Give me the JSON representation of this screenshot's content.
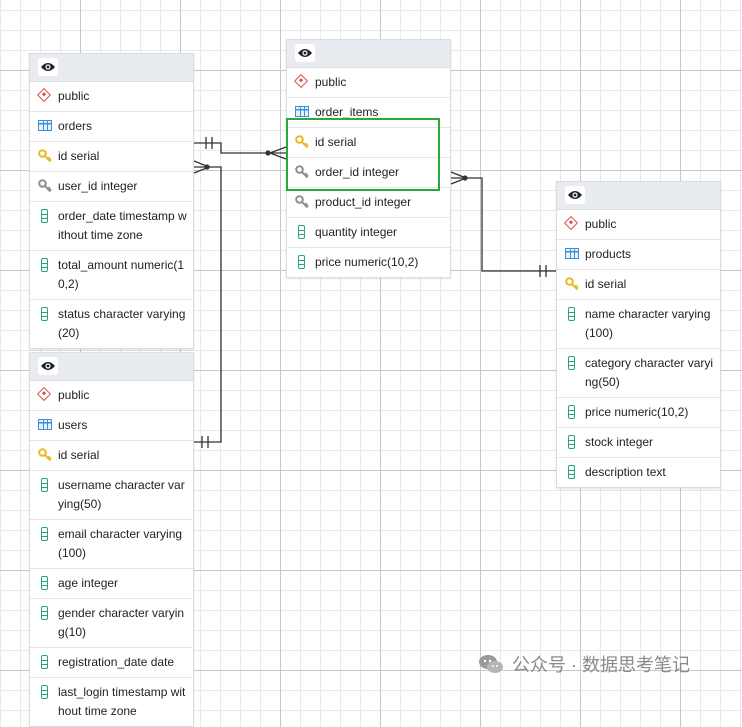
{
  "tables": [
    {
      "id": "orders",
      "schema": "public",
      "name": "orders",
      "columns": [
        {
          "text": "id serial",
          "kind": "pk"
        },
        {
          "text": "user_id integer",
          "kind": "fk"
        },
        {
          "text": "order_date timestamp without time zone",
          "kind": "col"
        },
        {
          "text": "total_amount numeric(10,2)",
          "kind": "col"
        },
        {
          "text": "status character varying(20)",
          "kind": "col"
        }
      ]
    },
    {
      "id": "order_items",
      "schema": "public",
      "name": "order_items",
      "columns": [
        {
          "text": "id serial",
          "kind": "pk"
        },
        {
          "text": "order_id integer",
          "kind": "fk"
        },
        {
          "text": "product_id integer",
          "kind": "fk"
        },
        {
          "text": "quantity integer",
          "kind": "col"
        },
        {
          "text": "price numeric(10,2)",
          "kind": "col"
        }
      ]
    },
    {
      "id": "products",
      "schema": "public",
      "name": "products",
      "columns": [
        {
          "text": "id serial",
          "kind": "pk"
        },
        {
          "text": "name character varying(100)",
          "kind": "col"
        },
        {
          "text": "category character varying(50)",
          "kind": "col"
        },
        {
          "text": "price numeric(10,2)",
          "kind": "col"
        },
        {
          "text": "stock integer",
          "kind": "col"
        },
        {
          "text": "description text",
          "kind": "col"
        }
      ]
    },
    {
      "id": "users",
      "schema": "public",
      "name": "users",
      "columns": [
        {
          "text": "id serial",
          "kind": "pk"
        },
        {
          "text": "username character varying(50)",
          "kind": "col"
        },
        {
          "text": "email character varying(100)",
          "kind": "col"
        },
        {
          "text": "age integer",
          "kind": "col"
        },
        {
          "text": "gender character varying(10)",
          "kind": "col"
        },
        {
          "text": "registration_date date",
          "kind": "col"
        },
        {
          "text": "last_login timestamp without time zone",
          "kind": "col"
        }
      ]
    }
  ],
  "relationships": [
    {
      "from": "order_items.order_id",
      "to": "orders.id",
      "cardinality": "many-to-one"
    },
    {
      "from": "order_items.product_id",
      "to": "products.id",
      "cardinality": "many-to-one"
    },
    {
      "from": "orders.user_id",
      "to": "users.id",
      "cardinality": "many-to-one"
    }
  ],
  "highlight": {
    "table": "order_items",
    "columns": [
      "id serial",
      "order_id integer",
      "product_id integer"
    ],
    "color": "#2aa83a"
  },
  "icons": {
    "header": "eye-icon",
    "schema": "schema-icon",
    "table": "table-icon",
    "pk": "primary-key-icon",
    "fk": "foreign-key-icon",
    "col": "column-icon"
  },
  "colors": {
    "pk_key": "#e8b923",
    "fk_key": "#8a8f96",
    "schema": "#d9534f",
    "table": "#3d8fd6",
    "column": "#2aa37a"
  },
  "watermark": {
    "text": "公众号 · 数据思考笔记"
  }
}
